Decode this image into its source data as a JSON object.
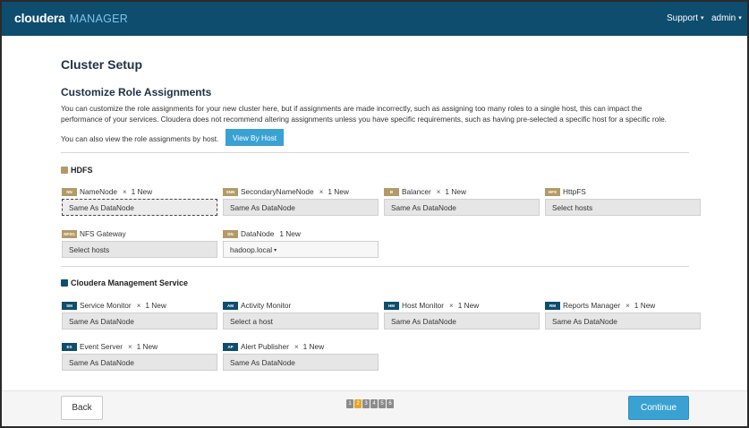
{
  "header": {
    "brand": "cloudera",
    "product": "MANAGER",
    "support_label": "Support",
    "user_label": "admin"
  },
  "page": {
    "title": "Cluster Setup",
    "section_title": "Customize Role Assignments",
    "description": "You can customize the role assignments for your new cluster here, but if assignments are made incorrectly, such as assigning too many roles to a single host, this can impact the performance of your services. Cloudera does not recommend altering assignments unless you have specific requirements, such as having pre-selected a specific host for a specific role.",
    "by_host_text": "You can also view the role assignments by host.",
    "view_by_host_label": "View By Host"
  },
  "hdfs": {
    "title": "HDFS",
    "roles": [
      {
        "abbr": "NN",
        "name": "NameNode",
        "count": "1 New",
        "value": "Same As DataNode"
      },
      {
        "abbr": "SNN",
        "name": "SecondaryNameNode",
        "count": "1 New",
        "value": "Same As DataNode"
      },
      {
        "abbr": "B",
        "name": "Balancer",
        "count": "1 New",
        "value": "Same As DataNode"
      },
      {
        "abbr": "HFS",
        "name": "HttpFS",
        "count": "",
        "value": "Select hosts"
      },
      {
        "abbr": "NFSG",
        "name": "NFS Gateway",
        "count": "",
        "value": "Select hosts"
      },
      {
        "abbr": "DN",
        "name": "DataNode",
        "count": "1 New",
        "value": "hadoop.local"
      }
    ]
  },
  "cms": {
    "title": "Cloudera Management Service",
    "roles": [
      {
        "abbr": "SM",
        "name": "Service Monitor",
        "count": "1 New",
        "value": "Same As DataNode"
      },
      {
        "abbr": "AM",
        "name": "Activity Monitor",
        "count": "",
        "value": "Select a host"
      },
      {
        "abbr": "HM",
        "name": "Host Monitor",
        "count": "1 New",
        "value": "Same As DataNode"
      },
      {
        "abbr": "RM",
        "name": "Reports Manager",
        "count": "1 New",
        "value": "Same As DataNode"
      },
      {
        "abbr": "ES",
        "name": "Event Server",
        "count": "1 New",
        "value": "Same As DataNode"
      },
      {
        "abbr": "AP",
        "name": "Alert Publisher",
        "count": "1 New",
        "value": "Same As DataNode"
      }
    ]
  },
  "remove_glyph": "×",
  "footer": {
    "back_label": "Back",
    "continue_label": "Continue",
    "steps": [
      "1",
      "2",
      "3",
      "4",
      "5",
      "6"
    ],
    "current_step": "2"
  },
  "colors": {
    "header_bg": "#0e4d6e",
    "accent": "#3aa1d3",
    "hdfs_badge": "#b39a68",
    "active_step": "#e5a52b"
  }
}
